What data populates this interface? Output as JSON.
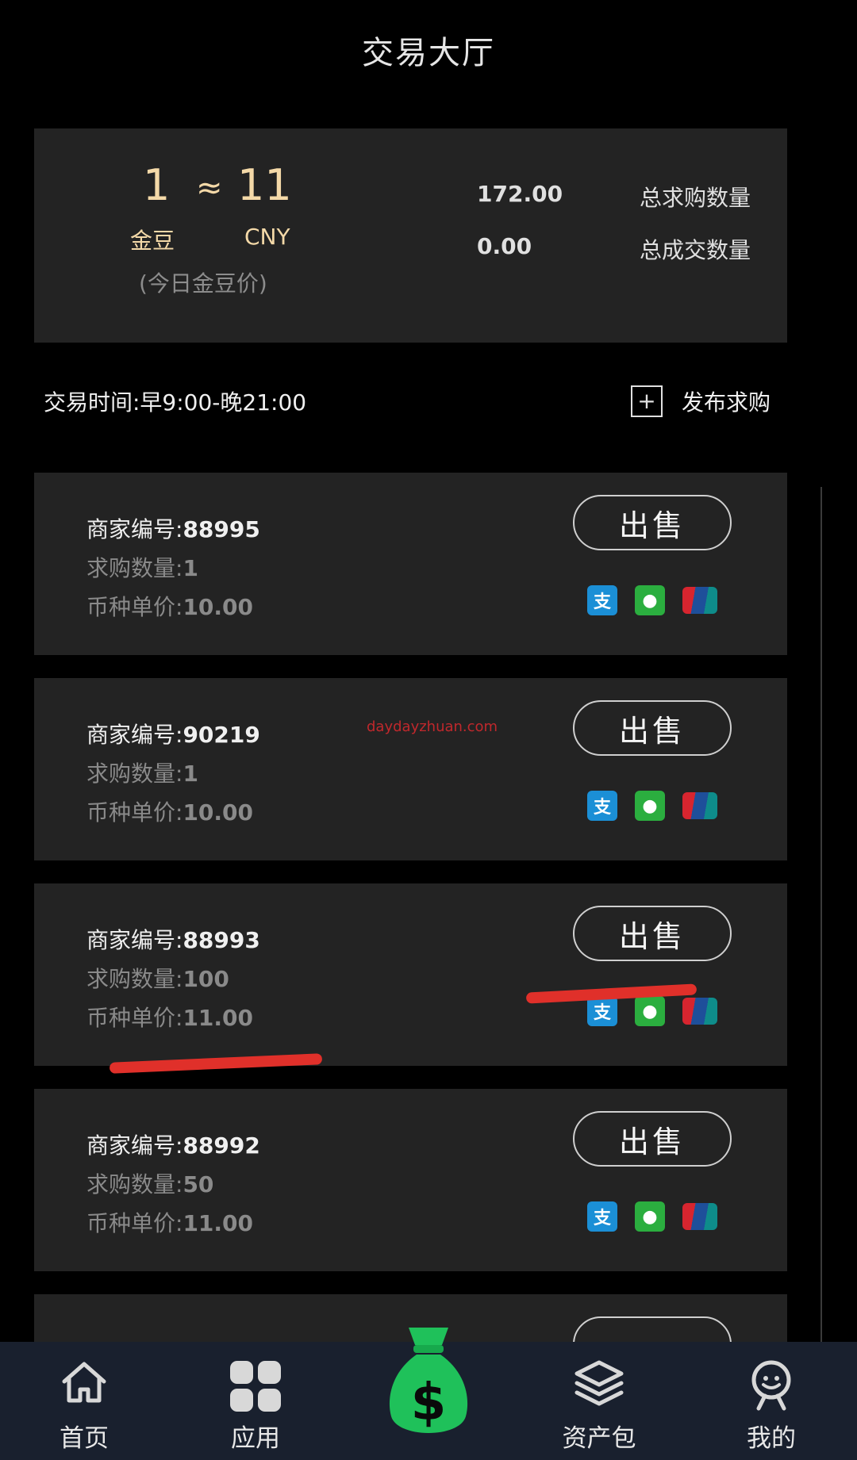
{
  "header": {
    "title": "交易大厅"
  },
  "summary": {
    "rate_left": "1",
    "rate_approx": "≈",
    "rate_right": "11",
    "unit_left": "金豆",
    "unit_right": "CNY",
    "rate_note": "(今日金豆价)",
    "stats": [
      {
        "value": "172.00",
        "label": "总求购数量"
      },
      {
        "value": "0.00",
        "label": "总成交数量"
      }
    ]
  },
  "info": {
    "trade_time": "交易时间:早9:00-晚21:00",
    "publish_icon": "plus-square-icon",
    "publish_label": "发布求购"
  },
  "labels": {
    "merchant": "商家编号:",
    "qty": "求购数量:",
    "price": "币种单价:"
  },
  "cards": [
    {
      "merchant": "88995",
      "qty": "1",
      "price": "10.00",
      "sell_label": "出售"
    },
    {
      "merchant": "90219",
      "qty": "1",
      "price": "10.00",
      "sell_label": "出售"
    },
    {
      "merchant": "88993",
      "qty": "100",
      "price": "11.00",
      "sell_label": "出售"
    },
    {
      "merchant": "88992",
      "qty": "50",
      "price": "11.00",
      "sell_label": "出售"
    }
  ],
  "payment_icons": [
    "alipay-icon",
    "wechat-pay-icon",
    "unionpay-icon"
  ],
  "watermark": "daydayzhuan.com",
  "tabs": [
    {
      "label": "首页",
      "icon": "home-icon"
    },
    {
      "label": "应用",
      "icon": "apps-grid-icon"
    },
    {
      "label": "",
      "icon": "money-bag-icon"
    },
    {
      "label": "资产包",
      "icon": "layers-icon"
    },
    {
      "label": "我的",
      "icon": "user-avatar-icon"
    }
  ],
  "colors": {
    "accent_gold": "#f4d9a8",
    "card_bg": "#232323",
    "tabbar_bg": "#19202e",
    "money_green": "#1fc15a",
    "annotation_red": "#e0302a"
  }
}
